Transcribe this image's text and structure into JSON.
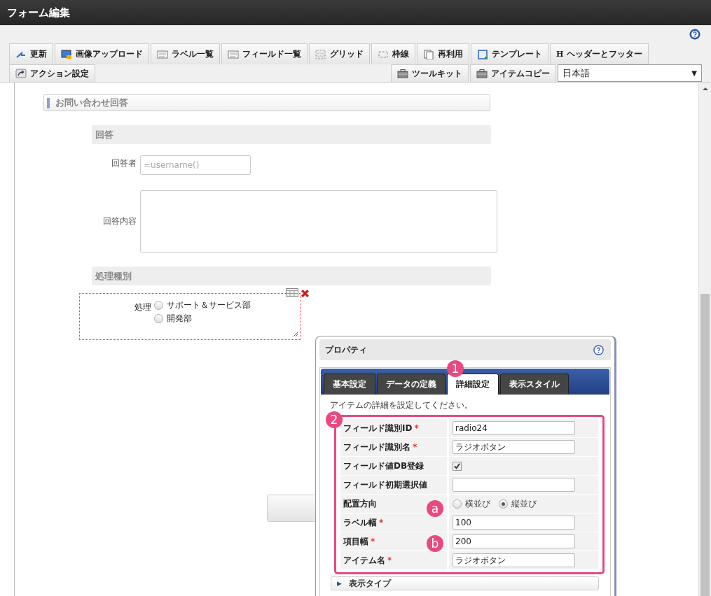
{
  "window": {
    "title": "フォーム編集"
  },
  "toolbar": {
    "tabs": [
      {
        "label": "更新"
      },
      {
        "label": "画像アップロード"
      },
      {
        "label": "ラベル一覧"
      },
      {
        "label": "フィールド一覧"
      },
      {
        "label": "グリッド"
      },
      {
        "label": "枠線"
      },
      {
        "label": "再利用"
      },
      {
        "label": "テンプレート"
      },
      {
        "label": "ヘッダーとフッター",
        "icon_text": "H"
      }
    ],
    "left_tabs": [
      {
        "label": "アクション設定"
      }
    ],
    "right_tabs": [
      {
        "label": "ツールキット"
      },
      {
        "label": "アイテムコピー"
      }
    ],
    "language": {
      "value": "日本語",
      "arrow": "▼"
    }
  },
  "form": {
    "section": "お問い合わせ回答",
    "subsections": [
      {
        "title": "回答",
        "fields": [
          {
            "kind": "input",
            "label": "回答者",
            "placeholder": "=username()"
          },
          {
            "kind": "textarea",
            "label": "回答内容"
          }
        ]
      },
      {
        "title": "処理種別",
        "fields": [
          {
            "kind": "radio",
            "label": "処理",
            "options": [
              {
                "label": "サポート＆サービス部",
                "selected": false
              },
              {
                "label": "開発部",
                "selected": false
              }
            ]
          }
        ]
      }
    ]
  },
  "properties": {
    "title": "プロパティ",
    "tabs": [
      {
        "label": "基本設定",
        "selected": false
      },
      {
        "label": "データの定義",
        "selected": false
      },
      {
        "label": "詳細設定",
        "selected": true
      },
      {
        "label": "表示スタイル",
        "selected": false
      }
    ],
    "description": "アイテムの詳細を設定してください。",
    "rows": [
      {
        "kind": "text",
        "label": "フィールド識別ID",
        "required": "*",
        "value": "radio24"
      },
      {
        "kind": "text",
        "label": "フィールド識別名",
        "required": "*",
        "value": "ラジオボタン"
      },
      {
        "kind": "checkbox",
        "label": "フィールド値DB登録",
        "checked": true
      },
      {
        "kind": "text",
        "label": "フィールド初期選択値"
      },
      {
        "kind": "radio",
        "label": "配置方向",
        "options": [
          {
            "label": "横並び",
            "selected": false
          },
          {
            "label": "縦並び",
            "selected": true
          }
        ]
      },
      {
        "kind": "text",
        "label": "ラベル幅",
        "required": "*",
        "value": "100"
      },
      {
        "kind": "text",
        "label": "項目幅",
        "required": "*",
        "value": "200"
      },
      {
        "kind": "text",
        "label": "アイテム名",
        "required": "*",
        "value": "ラジオボタン"
      }
    ],
    "collapsed_section": {
      "arrow": "▶",
      "label": "表示タイプ"
    }
  },
  "annotations": [
    {
      "label": "1"
    },
    {
      "label": "2"
    },
    {
      "label": "a"
    },
    {
      "label": "b"
    }
  ]
}
